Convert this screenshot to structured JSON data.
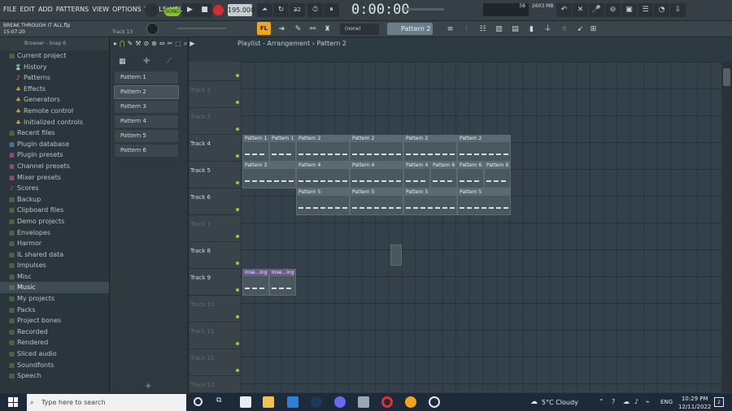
{
  "menu": [
    "FILE",
    "EDIT",
    "ADD",
    "PATTERNS",
    "VIEW",
    "OPTIONS",
    "TOOLS",
    "HELP"
  ],
  "transport": {
    "mode": "SONG",
    "bpm": "195.000",
    "time": "0:00:00",
    "cpu": "58",
    "memory": "2603 MB"
  },
  "project": {
    "name": "BREAK THROUGH IT ALL.flp",
    "time": "15:07:20",
    "track_hint": "Track 13"
  },
  "toolbar": {
    "preset": "(none)",
    "pattern_selector": "Pattern 2"
  },
  "browser": {
    "header": "Browser - Snap 6",
    "items": [
      {
        "label": "Current project",
        "icon": "folder-icon"
      },
      {
        "label": "History",
        "icon": "history-icon"
      },
      {
        "label": "Patterns",
        "icon": "note-icon"
      },
      {
        "label": "Effects",
        "icon": "effects-icon"
      },
      {
        "label": "Generators",
        "icon": "generator-icon"
      },
      {
        "label": "Remote control",
        "icon": "remote-icon"
      },
      {
        "label": "Initialized controls",
        "icon": "controls-icon"
      },
      {
        "label": "Recent files",
        "icon": "folder-icon"
      },
      {
        "label": "Plugin database",
        "icon": "plugin-icon"
      },
      {
        "label": "Plugin presets",
        "icon": "preset-icon"
      },
      {
        "label": "Channel presets",
        "icon": "preset-icon"
      },
      {
        "label": "Mixer presets",
        "icon": "preset-icon"
      },
      {
        "label": "Scores",
        "icon": "score-icon"
      },
      {
        "label": "Backup",
        "icon": "folder-icon"
      },
      {
        "label": "Clipboard files",
        "icon": "folder-icon"
      },
      {
        "label": "Demo projects",
        "icon": "folder-icon"
      },
      {
        "label": "Envelopes",
        "icon": "folder-icon"
      },
      {
        "label": "Harmor",
        "icon": "folder-icon"
      },
      {
        "label": "IL shared data",
        "icon": "folder-icon"
      },
      {
        "label": "Impulses",
        "icon": "folder-icon"
      },
      {
        "label": "Misc",
        "icon": "folder-icon"
      },
      {
        "label": "Music",
        "icon": "folder-icon"
      },
      {
        "label": "My projects",
        "icon": "folder-icon"
      },
      {
        "label": "Packs",
        "icon": "folder-icon"
      },
      {
        "label": "Project bones",
        "icon": "folder-icon"
      },
      {
        "label": "Recorded",
        "icon": "folder-icon"
      },
      {
        "label": "Rendered",
        "icon": "folder-icon"
      },
      {
        "label": "Sliced audio",
        "icon": "folder-icon"
      },
      {
        "label": "Soundfonts",
        "icon": "folder-icon"
      },
      {
        "label": "Speech",
        "icon": "folder-icon"
      }
    ]
  },
  "patterns": [
    "Pattern 1",
    "Pattern 2",
    "Pattern 3",
    "Pattern 4",
    "Pattern 5",
    "Pattern 6"
  ],
  "playlist": {
    "title": "Playlist - Arrangement",
    "breadcrumb": "Pattern 2",
    "ruler": [
      "2",
      "3",
      "4",
      "5",
      "6",
      "7",
      "8",
      "9",
      "10",
      "11",
      "12",
      "13",
      "14",
      "15",
      "16",
      "17",
      "18",
      "19",
      "20",
      "21",
      "22",
      "23",
      "24",
      "25",
      "26",
      "27",
      "28",
      "29",
      "30",
      "31",
      "32",
      "33",
      "34",
      "35",
      "36"
    ],
    "tracks": [
      "",
      "Track 2",
      "Track 3",
      "Track 4",
      "Track 5",
      "Track 6",
      "Track 7",
      "Track 8",
      "Track 9",
      "Track 10",
      "Track 11",
      "Track 12",
      "Track 13"
    ],
    "clips": [
      {
        "label": "Pattern 1",
        "track": 3,
        "start": 0,
        "len": 2
      },
      {
        "label": "Pattern 1",
        "track": 3,
        "start": 2,
        "len": 2
      },
      {
        "label": "Pattern 2",
        "track": 3,
        "start": 4,
        "len": 4
      },
      {
        "label": "Pattern 2",
        "track": 3,
        "start": 8,
        "len": 4
      },
      {
        "label": "Pattern 2",
        "track": 3,
        "start": 12,
        "len": 4
      },
      {
        "label": "Pattern 2",
        "track": 3,
        "start": 16,
        "len": 4
      },
      {
        "label": "Pattern 3",
        "track": 4,
        "start": 0,
        "len": 4
      },
      {
        "label": "Pattern 4",
        "track": 4,
        "start": 4,
        "len": 4
      },
      {
        "label": "Pattern 4",
        "track": 4,
        "start": 8,
        "len": 4
      },
      {
        "label": "Pattern 4",
        "track": 4,
        "start": 12,
        "len": 2
      },
      {
        "label": "Pattern 6",
        "track": 4,
        "start": 14,
        "len": 2
      },
      {
        "label": "Pattern 6",
        "track": 4,
        "start": 16,
        "len": 2
      },
      {
        "label": "Pattern 6",
        "track": 4,
        "start": 18,
        "len": 2
      },
      {
        "label": "Pattern 5",
        "track": 5,
        "start": 4,
        "len": 4
      },
      {
        "label": "Pattern 5",
        "track": 5,
        "start": 8,
        "len": 4
      },
      {
        "label": "Pattern 5",
        "track": 5,
        "start": 12,
        "len": 4
      },
      {
        "label": "Pattern 5",
        "track": 5,
        "start": 16,
        "len": 4
      },
      {
        "label": "Inse...ing",
        "track": 8,
        "start": 0,
        "len": 2,
        "audio": true
      },
      {
        "label": "Inse...ing",
        "track": 8,
        "start": 2,
        "len": 2,
        "audio": true
      }
    ]
  },
  "taskbar": {
    "search_placeholder": "Type here to search",
    "weather": "5°C  Cloudy",
    "lang": "ENG",
    "time": "10:29 PM",
    "date": "12/11/2022",
    "notifications": "2"
  }
}
